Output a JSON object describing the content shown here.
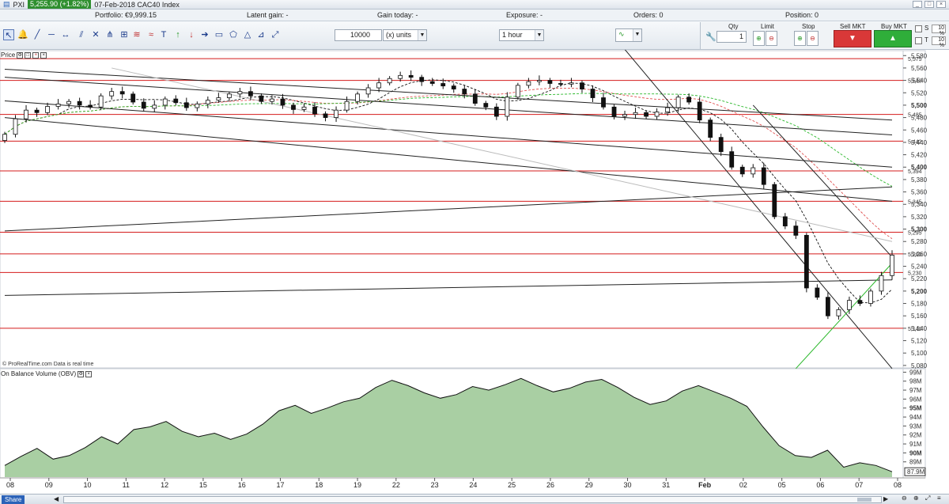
{
  "window": {
    "title": "PXI",
    "price_badge": "5,255.90 (+1.82%)",
    "subtitle": "07-Feb-2018 CAC40 Index"
  },
  "infobar": {
    "portfolio": "Portfolio: €9,999.15",
    "latent_gain": "Latent gain: -",
    "gain_today": "Gain today: -",
    "exposure": "Exposure: -",
    "orders": "Orders: 0",
    "position": "Position: 0"
  },
  "toolbar": {
    "quantity": "10000",
    "units": "(x) units",
    "timeframe": "1 hour"
  },
  "trade": {
    "qty_label": "Qty",
    "qty_value": "1",
    "limit_label": "Limit",
    "stop_label": "Stop",
    "sell_label": "Sell MKT",
    "buy_label": "Buy MKT",
    "s_label": "S",
    "t_label": "T",
    "pct": "%"
  },
  "price_panel": {
    "title": "Price",
    "footer": "© ProRealTime.com  Data is real time"
  },
  "obv_panel": {
    "title": "On Balance Volume (OBV)"
  },
  "bottombar": {
    "share_label": "Share"
  },
  "chart_data": [
    {
      "type": "line",
      "title": "Price",
      "candle_style": "candlestick",
      "price_axis": {
        "ticks": [
          5080,
          5100,
          5120,
          5140,
          5160,
          5180,
          5200,
          5220,
          5240,
          5260,
          5280,
          5300,
          5320,
          5340,
          5360,
          5380,
          5400,
          5420,
          5440,
          5460,
          5480,
          5500,
          5520,
          5540,
          5560,
          5580
        ],
        "bold_ticks": [
          5200,
          5300,
          5400,
          5500
        ],
        "range": [
          5076,
          5588
        ]
      },
      "x_ticks": [
        "08",
        "09",
        "10",
        "11",
        "12",
        "15",
        "16",
        "17",
        "18",
        "19",
        "22",
        "23",
        "24",
        "25",
        "26",
        "29",
        "30",
        "31",
        "Feb",
        "02",
        "05",
        "06",
        "07",
        "08"
      ],
      "horizontal_levels": [
        5575,
        5540,
        5485,
        5442,
        5394,
        5345,
        5295,
        5260,
        5230,
        5140
      ],
      "level_labels": [
        "5,575",
        "5,540",
        "5,485",
        "5,442",
        "5,394",
        "5,345",
        "5,295",
        "5,260",
        "5,230",
        "5,140"
      ],
      "close_series": [
        5453,
        5478,
        5492,
        5488,
        5498,
        5502,
        5506,
        5500,
        5497,
        5515,
        5522,
        5518,
        5505,
        5495,
        5500,
        5510,
        5504,
        5496,
        5502,
        5508,
        5512,
        5518,
        5522,
        5515,
        5506,
        5510,
        5500,
        5493,
        5497,
        5486,
        5480,
        5492,
        5506,
        5518,
        5528,
        5536,
        5543,
        5548,
        5545,
        5538,
        5535,
        5531,
        5526,
        5518,
        5503,
        5497,
        5482,
        5513,
        5532,
        5538,
        5540,
        5535,
        5534,
        5536,
        5526,
        5512,
        5497,
        5482,
        5485,
        5488,
        5482,
        5489,
        5496,
        5513,
        5505,
        5476,
        5448,
        5425,
        5400,
        5389,
        5399,
        5372,
        5320,
        5305,
        5290,
        5205,
        5190,
        5160,
        5170,
        5185,
        5180,
        5200,
        5225,
        5258
      ]
    },
    {
      "type": "area",
      "title": "On Balance Volume (OBV)",
      "y_axis": {
        "ticks": [
          "89M",
          "90M",
          "91M",
          "92M",
          "93M",
          "94M",
          "95M",
          "96M",
          "97M",
          "98M",
          "99M"
        ],
        "bold_ticks": [
          "90M",
          "95M"
        ],
        "current_label": "87.9M",
        "range": [
          87.3,
          99.3
        ]
      },
      "values": [
        88.6,
        89.6,
        90.5,
        89.3,
        89.7,
        90.6,
        91.8,
        91.0,
        92.6,
        92.9,
        93.5,
        92.4,
        91.8,
        92.2,
        91.5,
        92.1,
        93.2,
        94.7,
        95.3,
        94.4,
        95.0,
        95.7,
        96.1,
        97.3,
        98.1,
        97.5,
        96.7,
        96.1,
        96.5,
        97.4,
        97.0,
        97.6,
        98.3,
        97.5,
        96.8,
        97.2,
        97.9,
        98.2,
        97.3,
        96.2,
        95.4,
        95.8,
        96.9,
        97.5,
        96.8,
        96.1,
        95.2,
        92.9,
        90.8,
        89.7,
        89.5,
        90.3,
        88.4,
        88.9,
        88.6,
        87.9
      ]
    }
  ]
}
